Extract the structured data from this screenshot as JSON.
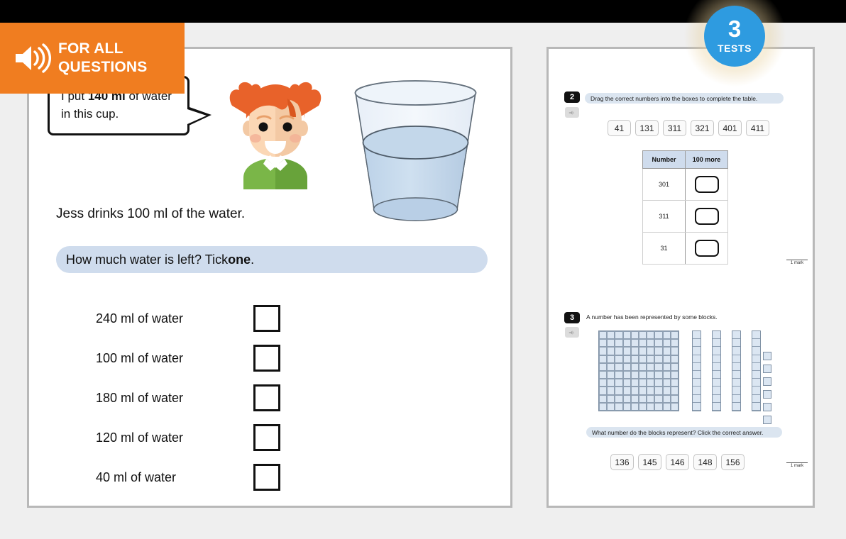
{
  "banner": {
    "icon": "speaker-icon",
    "line1": "FOR ALL",
    "line2": "QUESTIONS"
  },
  "badge": {
    "number": "3",
    "label": "TESTS"
  },
  "left_panel": {
    "speech_bubble": {
      "part1": "I put ",
      "bold": "140 ml",
      "part2": " of water in this cup."
    },
    "character": "girl-avatar",
    "illustration": "cup-of-water",
    "statement": "Jess drinks 100 ml of the water.",
    "question": {
      "part1": "How much water is left? Tick ",
      "bold": "one",
      "part2": "."
    },
    "options": [
      {
        "label": "240 ml of water"
      },
      {
        "label": "100 ml of water"
      },
      {
        "label": "180 ml of water"
      },
      {
        "label": "120 ml of water"
      },
      {
        "label": "40 ml of water"
      }
    ]
  },
  "right_panel": {
    "question2": {
      "number": "2",
      "speaker": "speaker-icon",
      "prompt": "Drag the correct numbers into the boxes to complete the table.",
      "tiles": [
        "41",
        "131",
        "311",
        "321",
        "401",
        "411"
      ],
      "table": {
        "headers": [
          "Number",
          "100 more"
        ],
        "rows": [
          {
            "number": "301",
            "answer": ""
          },
          {
            "number": "311",
            "answer": ""
          },
          {
            "number": "31",
            "answer": ""
          }
        ]
      },
      "mark": "1 mark"
    },
    "question3": {
      "number": "3",
      "speaker": "speaker-icon",
      "prompt": "A number has been represented by some blocks.",
      "blocks": {
        "hundreds": 1,
        "tens": 4,
        "ones": 6
      },
      "answer_prompt": "What number do the blocks represent? Click the correct answer.",
      "tiles": [
        "136",
        "145",
        "146",
        "148",
        "156"
      ],
      "mark": "1 mark"
    }
  },
  "colors": {
    "banner_orange": "#f07d20",
    "badge_blue": "#2e9be0",
    "question_bar_blue": "#cfdced",
    "panel_border": "#b8b8b8",
    "page_bg": "#efefef"
  }
}
